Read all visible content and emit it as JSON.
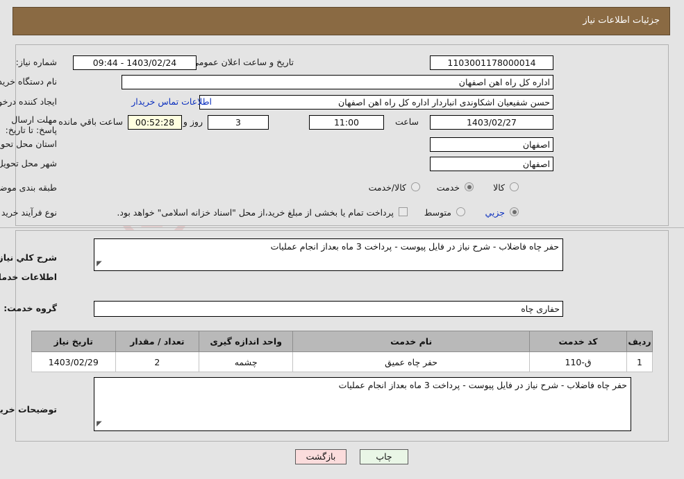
{
  "header": {
    "title": "جزئیات اطلاعات نیاز"
  },
  "top_form": {
    "need_number_label": "شماره نیاز:",
    "need_number_value": "1103001178000014",
    "public_announce_label": "تاریخ و ساعت اعلان عمومي:",
    "public_announce_value": "1403/02/24 - 09:44",
    "buyer_org_label": "نام دستگاه خریدار:",
    "buyer_org_value": "اداره کل راه اهن اصفهان",
    "creator_label": "ایجاد کننده درخواست:",
    "creator_value": "حسن شفیعیان اشکاوندی انباردار اداره کل راه اهن اصفهان",
    "buyer_contact_link": "اطلاعات تماس خریدار",
    "deadline_label": "مهلت ارسال پاسخ: تا تاریخ:",
    "deadline_date": "1403/02/27",
    "hour_label": "ساعت",
    "deadline_time": "11:00",
    "days_value": "3",
    "days_label": "روز و",
    "countdown_value": "00:52:28",
    "remaining_label": "ساعت باقي مانده",
    "province_label": "استان محل تحویل:",
    "province_value": "اصفهان",
    "city_label": "شهر محل تحویل:",
    "city_value": "اصفهان",
    "category_label": "طبقه بندی موضوعی:",
    "category_options": [
      {
        "label": "کالا",
        "selected": false
      },
      {
        "label": "خدمت",
        "selected": true
      },
      {
        "label": "کالا/خدمت",
        "selected": false
      }
    ],
    "process_label": "نوع فرآیند خرید :",
    "process_options": [
      {
        "label": "جزیي",
        "selected": true
      },
      {
        "label": "متوسط",
        "selected": false
      }
    ],
    "treasury_checkbox_text": "پرداخت تمام یا بخشی از مبلغ خرید،از محل \"اسناد خزانه اسلامی\" خواهد بود.",
    "treasury_checked": false
  },
  "middle": {
    "general_desc_label": "شرح کلي نیاز:",
    "general_desc_value": "حفر چاه فاضلاب  - شرح نیاز در فایل پیوست - پرداخت 3 ماه بعداز انجام عملیات",
    "services_section_title": "اطلاعات خدمات مورد نیاز",
    "service_group_label": "گروه خدمت:",
    "service_group_value": "حفاری چاه",
    "buyer_notes_label": "توضیحات خریدار:",
    "buyer_notes_value": "حفر چاه فاضلاب  - شرح نیاز در فایل پیوست - پرداخت 3 ماه بعداز انجام عملیات"
  },
  "table": {
    "columns": [
      "ردیف",
      "کد خدمت",
      "نام خدمت",
      "واحد اندازه گیری",
      "تعداد / مقدار",
      "تاریخ نیاز"
    ],
    "rows": [
      {
        "radif": "1",
        "code": "ق-110",
        "name": "حفر چاه عمیق",
        "unit": "چشمه",
        "qty": "2",
        "date": "1403/02/29"
      }
    ]
  },
  "footer": {
    "print_label": "چاپ",
    "back_label": "بازگشت"
  },
  "watermark": {
    "text": "AriaTender.net"
  },
  "colors": {
    "header_band": "#8a6a43",
    "page_bg": "#e4e4e4",
    "table_header_bg": "#b9b9b9",
    "link_blue": "#0b2fbe",
    "countdown_bg": "#ffffe0",
    "print_btn_bg": "#e9f6e6",
    "back_btn_bg": "#fbdcdc"
  }
}
